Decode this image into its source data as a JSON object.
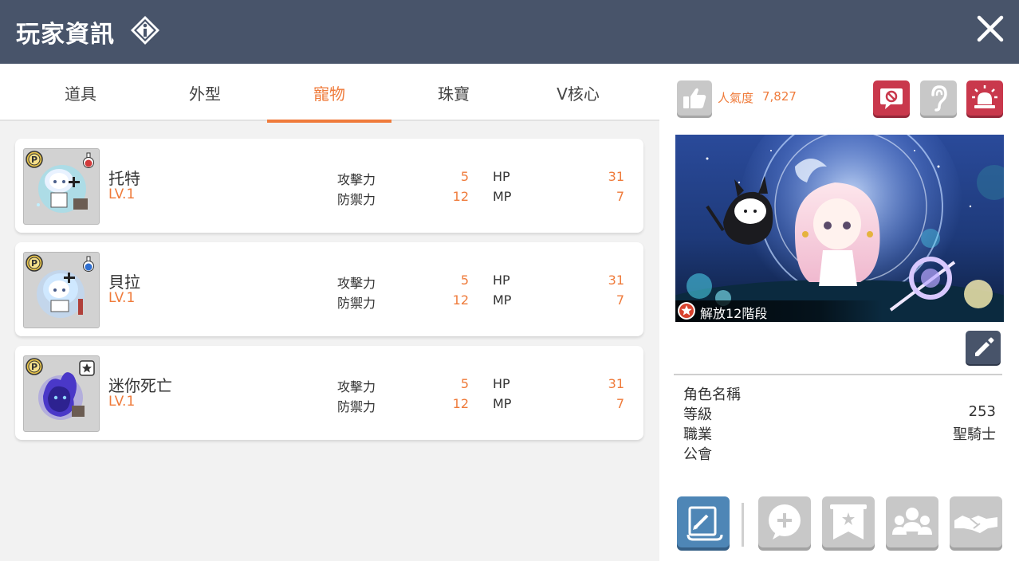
{
  "header": {
    "title": "玩家資訊",
    "info_icon": "info-diamond-icon",
    "close_icon": "close-icon"
  },
  "tabs": [
    {
      "label": "道具",
      "active": false
    },
    {
      "label": "外型",
      "active": false
    },
    {
      "label": "寵物",
      "active": true
    },
    {
      "label": "珠寶",
      "active": false
    },
    {
      "label": "V核心",
      "active": false
    }
  ],
  "pets": [
    {
      "name": "托特",
      "level": "LV.1",
      "attack_label": "攻擊力",
      "attack": "5",
      "defense_label": "防禦力",
      "defense": "12",
      "hp_label": "HP",
      "hp": "31",
      "mp_label": "MP",
      "mp": "7",
      "badge_icon": "red-potion-icon"
    },
    {
      "name": "貝拉",
      "level": "LV.1",
      "attack_label": "攻擊力",
      "attack": "5",
      "defense_label": "防禦力",
      "defense": "12",
      "hp_label": "HP",
      "hp": "31",
      "mp_label": "MP",
      "mp": "7",
      "badge_icon": "blue-potion-icon"
    },
    {
      "name": "迷你死亡",
      "level": "LV.1",
      "attack_label": "攻擊力",
      "attack": "5",
      "defense_label": "防禦力",
      "defense": "12",
      "hp_label": "HP",
      "hp": "31",
      "mp_label": "MP",
      "mp": "7",
      "badge_icon": "star-box-icon"
    }
  ],
  "profile": {
    "popularity_label": "人氣度",
    "popularity_value": "7,827",
    "stage_text": "解放12階段",
    "info": [
      {
        "label": "角色名稱",
        "value": ""
      },
      {
        "label": "等級",
        "value": "253"
      },
      {
        "label": "職業",
        "value": "聖騎士"
      },
      {
        "label": "公會",
        "value": ""
      }
    ]
  },
  "colors": {
    "header_bg": "#48546a",
    "accent": "#ef7b3b",
    "red_button": "#c9384c",
    "blue_button": "#4e86b6",
    "gray_button": "#c8c8c8"
  }
}
